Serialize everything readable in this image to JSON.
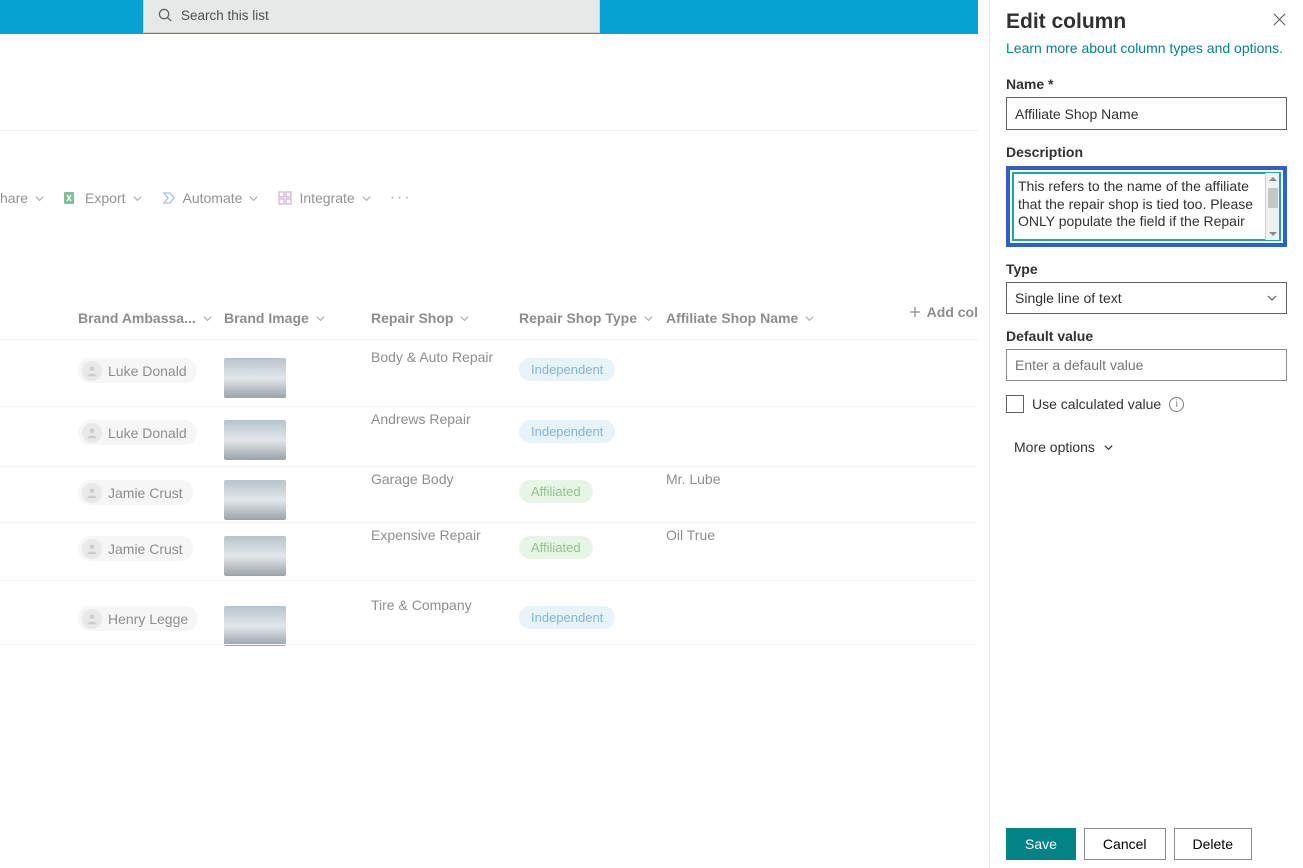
{
  "search": {
    "placeholder": "Search this list"
  },
  "commands": {
    "share": "hare",
    "export": "Export",
    "automate": "Automate",
    "integrate": "Integrate"
  },
  "columns": {
    "brand_ambassador": "Brand Ambassa...",
    "brand_image": "Brand Image",
    "repair_shop": "Repair Shop",
    "repair_shop_type": "Repair Shop Type",
    "affiliate_shop_name": "Affiliate Shop Name",
    "add_column": "Add col"
  },
  "rows": [
    {
      "ambassador": "Luke Donald",
      "repair_shop": "Body & Auto Repair",
      "type": "Independent",
      "type_class": "ind",
      "affiliate": ""
    },
    {
      "ambassador": "Luke Donald",
      "repair_shop": "Andrews Repair",
      "type": "Independent",
      "type_class": "ind",
      "affiliate": ""
    },
    {
      "ambassador": "Jamie Crust",
      "repair_shop": "Garage Body",
      "type": "Affiliated",
      "type_class": "aff",
      "affiliate": "Mr. Lube"
    },
    {
      "ambassador": "Jamie Crust",
      "repair_shop": "Expensive Repair",
      "type": "Affiliated",
      "type_class": "aff",
      "affiliate": "Oil True"
    },
    {
      "ambassador": "Henry Legge",
      "repair_shop": "Tire & Company",
      "type": "Independent",
      "type_class": "ind",
      "affiliate": ""
    }
  ],
  "panel": {
    "title": "Edit column",
    "learn_more": "Learn more about column types and options.",
    "name_label": "Name *",
    "name_value": "Affiliate Shop Name",
    "description_label": "Description",
    "description_value": "This refers to the name of the affiliate that the repair shop is tied too. Please ONLY populate the field if the Repair Shop Type is \"Affiliate\"",
    "type_label": "Type",
    "type_value": "Single line of text",
    "default_label": "Default value",
    "default_placeholder": "Enter a default value",
    "calc_label": "Use calculated value",
    "more_options": "More options",
    "save": "Save",
    "cancel": "Cancel",
    "delete": "Delete"
  },
  "layout": {
    "col_x": {
      "amb": 0,
      "img": 146,
      "shop": 293,
      "type": 441,
      "aff": 588
    },
    "row_y": [
      312,
      374,
      434,
      490,
      560
    ],
    "border_y": [
      372,
      432,
      488,
      546,
      610
    ]
  }
}
